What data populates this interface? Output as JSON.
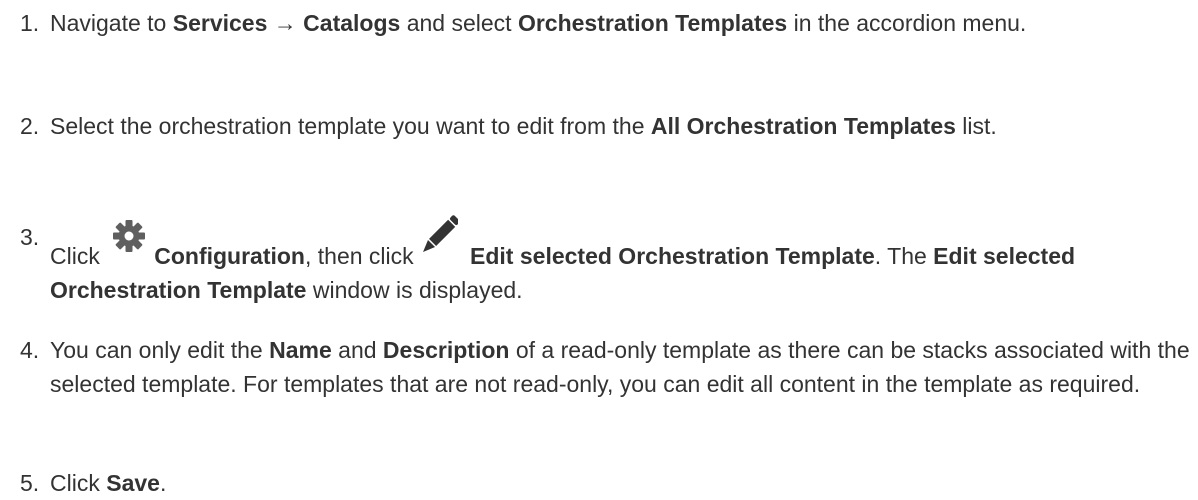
{
  "steps": [
    {
      "number": "1.",
      "parts": {
        "a": "Navigate to ",
        "b": "Services → Catalogs",
        "c": " and select ",
        "d": "Orchestration Templates",
        "e": " in the accordion menu."
      }
    },
    {
      "number": "2.",
      "parts": {
        "a": "Select the orchestration template you want to edit from the ",
        "b": "All Orchestration Templates",
        "c": " list."
      }
    },
    {
      "number": "3.",
      "parts": {
        "a": "Click ",
        "b": "Configuration",
        "c": ", then click ",
        "d": "Edit selected Orchestration Template",
        "e": ". The ",
        "f": "Edit selected Orchestration Template",
        "g": " window is displayed."
      },
      "icons": [
        "gear-icon",
        "pencil-icon"
      ]
    },
    {
      "number": "4.",
      "parts": {
        "a": "You can only edit the ",
        "b": "Name",
        "c": " and ",
        "d": "Description",
        "e": " of a read-only template as there can be stacks associated with the selected template. For templates that are not read-only, you can edit all content in the template as required."
      }
    },
    {
      "number": "5.",
      "parts": {
        "a": "Click ",
        "b": "Save",
        "c": "."
      }
    }
  ],
  "colors": {
    "text": "#333333",
    "icon": "#333333",
    "gear": "#5f5f5f"
  }
}
